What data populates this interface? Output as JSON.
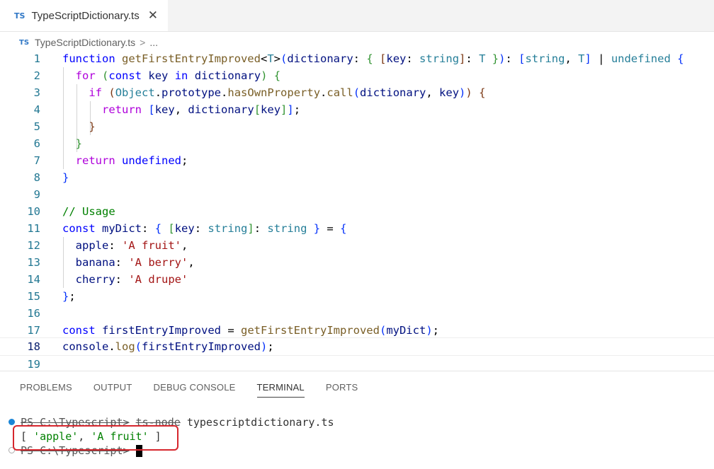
{
  "tab": {
    "lang_badge": "TS",
    "filename": "TypeScriptDictionary.ts",
    "close_glyph": "✕"
  },
  "breadcrumb": {
    "lang_badge": "TS",
    "file": "TypeScriptDictionary.ts",
    "separator": ">",
    "more": "..."
  },
  "editor": {
    "line_numbers": [
      "1",
      "2",
      "3",
      "4",
      "5",
      "6",
      "7",
      "8",
      "9",
      "10",
      "11",
      "12",
      "13",
      "14",
      "15",
      "16",
      "17",
      "18",
      "19"
    ],
    "current_line": "18"
  },
  "panel": {
    "tabs": [
      "PROBLEMS",
      "OUTPUT",
      "DEBUG CONSOLE",
      "TERMINAL",
      "PORTS"
    ],
    "active_tab": "TERMINAL"
  },
  "terminal": {
    "prompt": "PS C:\\Typescript>",
    "command": "ts-node",
    "argument": "typescriptdictionary.ts",
    "output_open": "[ ",
    "output_key": "'apple'",
    "output_comma": ", ",
    "output_value": "'A fruit'",
    "output_close": " ]",
    "prompt2": "PS C:\\Typescript>"
  },
  "colors": {
    "accent": "#007acc",
    "highlight_box": "#d6262d",
    "keyword": "#0000ff",
    "string": "#a31515"
  }
}
